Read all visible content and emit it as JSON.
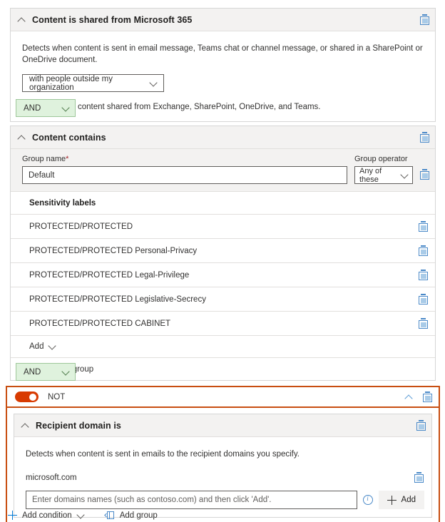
{
  "conditions": [
    {
      "id": "content-shared-m365",
      "title": "Content is shared from Microsoft 365",
      "description": "Detects when content is sent in email message, Teams chat or channel message, or shared in a SharePoint or OneDrive document.",
      "dropdown_value": "with people outside my organization",
      "footnote": "Applies only to content shared from Exchange, SharePoint, OneDrive, and Teams.",
      "delete_icon": "trash-icon",
      "collapse_icon": "chevron-up-icon"
    }
  ],
  "operator_1": {
    "label": "AND",
    "chevron": "chevron-down-icon"
  },
  "operator_2": {
    "label": "AND",
    "chevron": "chevron-down-icon"
  },
  "content_contains": {
    "title": "Content contains",
    "group_name_label": "Group name",
    "group_name_required": "*",
    "group_name_value": "Default",
    "group_operator_label": "Group operator",
    "group_operator_value": "Any of these",
    "section_header": "Sensitivity labels",
    "labels": [
      "PROTECTED/PROTECTED",
      "PROTECTED/PROTECTED Personal-Privacy",
      "PROTECTED/PROTECTED Legal-Privilege",
      "PROTECTED/PROTECTED Legislative-Secrecy",
      "PROTECTED/PROTECTED CABINET"
    ],
    "add_label": "Add",
    "create_group_label": "Create group",
    "create_group_icon": "people-group-icon"
  },
  "not_group": {
    "toggle_label": "NOT",
    "toggle_on": true,
    "toggle_color": "#d83b01",
    "border_color": "#c84e11",
    "collapse_icon": "chevron-up-icon",
    "delete_icon": "trash-icon",
    "condition": {
      "title": "Recipient domain is",
      "description": "Detects when content is sent in emails to the recipient domains you specify.",
      "domains": [
        "microsoft.com"
      ],
      "input_placeholder": "Enter domains names (such as contoso.com) and then click 'Add'.",
      "input_value": "",
      "info_icon": "info-circle-icon",
      "add_button_label": "Add"
    }
  },
  "footer": {
    "add_condition_label": "Add condition",
    "add_condition_icon": "plus-icon",
    "add_condition_chevron": "chevron-down-icon",
    "add_group_label": "Add group",
    "add_group_icon": "add-group-icon"
  }
}
